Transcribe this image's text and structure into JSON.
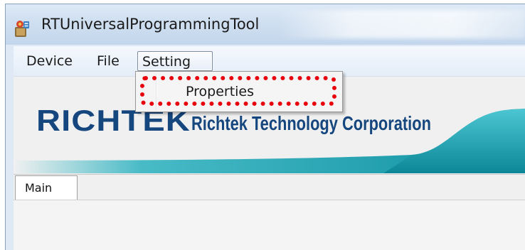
{
  "window": {
    "title": "RTUniversalProgrammingTool",
    "icon": "app-icon"
  },
  "menubar": {
    "items": [
      {
        "label": "Device"
      },
      {
        "label": "File"
      },
      {
        "label": "Setting",
        "active": true
      }
    ]
  },
  "setting_menu": {
    "items": [
      {
        "label": "Properties",
        "highlighted": true
      }
    ]
  },
  "banner": {
    "logo": "RICHTEK",
    "company": "Richtek Technology Corporation",
    "brand_color": "#15467e",
    "accent_color": "#1ba6b4"
  },
  "tabs": [
    {
      "label": "Main",
      "selected": true
    }
  ],
  "annotation": {
    "highlight_color": "#e8000b"
  }
}
